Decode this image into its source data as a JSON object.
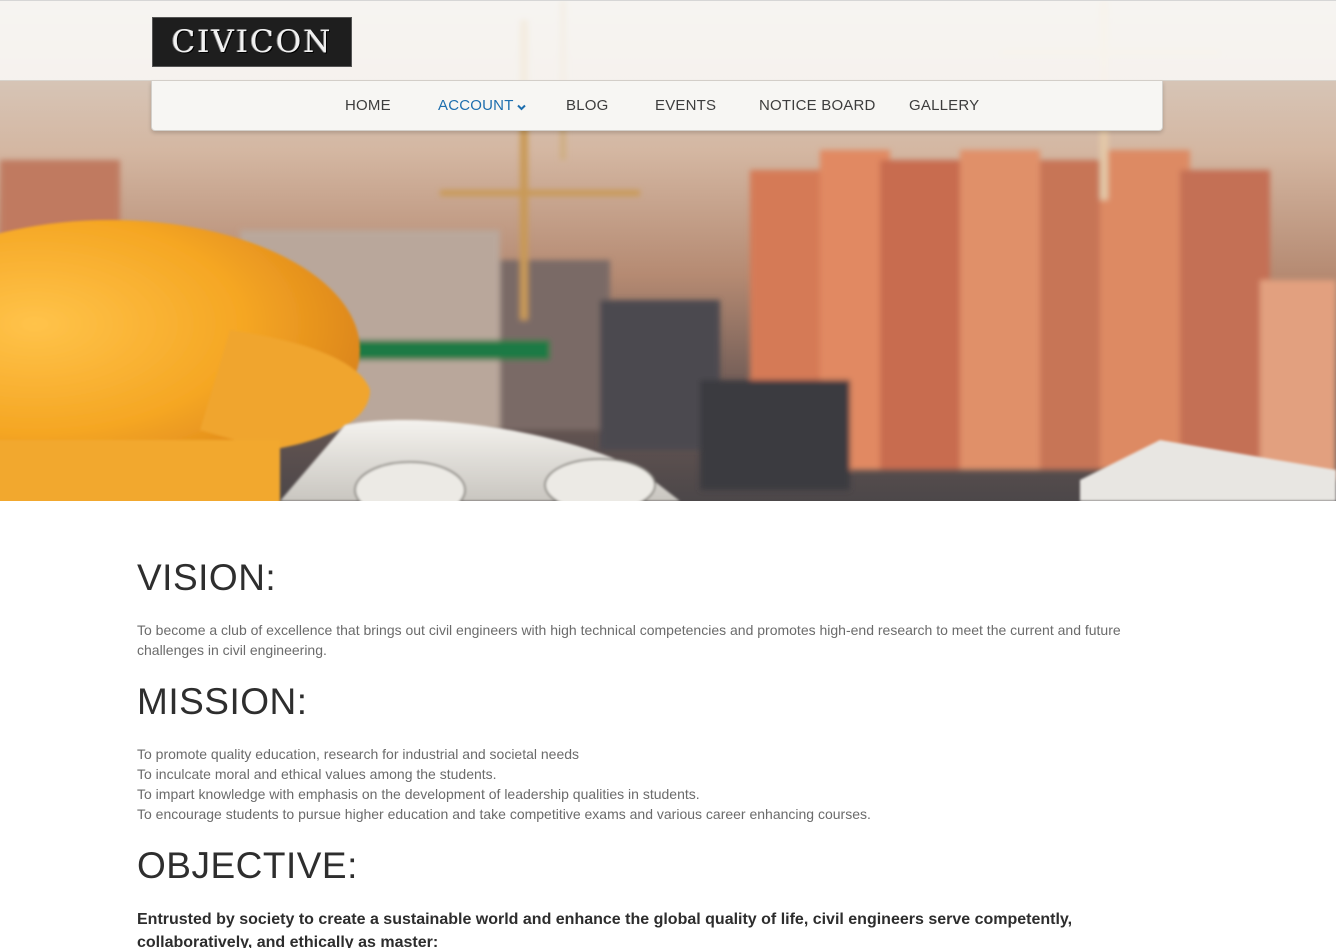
{
  "header": {
    "logo_text": "CIVICON"
  },
  "nav": {
    "items": [
      {
        "label": "HOME",
        "active": false
      },
      {
        "label": "ACCOUNT",
        "active": true,
        "has_dropdown": true
      },
      {
        "label": "BLOG",
        "active": false
      },
      {
        "label": "EVENTS",
        "active": false
      },
      {
        "label": "NOTICE BOARD",
        "active": false
      },
      {
        "label": "GALLERY",
        "active": false
      }
    ],
    "active_color": "#1d6eae",
    "text_color": "#3d3d3d"
  },
  "vision": {
    "heading": "VISION:",
    "lines": [
      "To become a club of excellence that brings out civil engineers with high technical competencies and promotes high-end research to meet the current and future",
      "challenges in civil engineering."
    ]
  },
  "mission": {
    "heading": "MISSION:",
    "lines": [
      "To promote quality education, research for industrial and societal needs",
      "To inculcate moral and ethical values among the students.",
      "To impart knowledge with emphasis on the development of leadership qualities in students.",
      "To encourage students to pursue higher education and take competitive exams and various career enhancing courses."
    ]
  },
  "objective": {
    "heading": "OBJECTIVE:",
    "text": "Entrusted by society to create a sustainable world and enhance the global quality of life, civil engineers serve competently, collaboratively, and ethically as master:"
  }
}
